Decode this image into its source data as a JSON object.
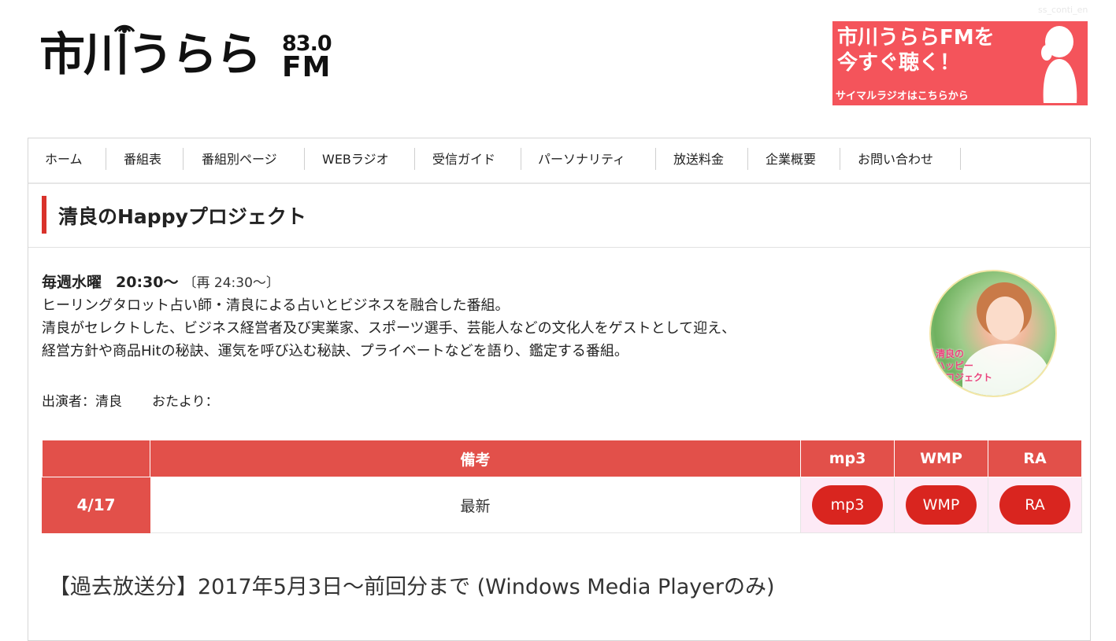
{
  "header": {
    "topnote": "ss_conti_en",
    "logo": {
      "text": "市川うらら",
      "frequency": "83.0",
      "band": "FM"
    },
    "banner": {
      "line1": "市川うららFMを",
      "line2": "今すぐ聴く！",
      "sub": "サイマルラジオはこちらから",
      "bg": "#f4545b"
    }
  },
  "nav": [
    {
      "label": "ホーム"
    },
    {
      "label": "番組表"
    },
    {
      "label": "番組別ページ"
    },
    {
      "label": "WEBラジオ"
    },
    {
      "label": "受信ガイド"
    },
    {
      "label": "パーソナリティ"
    },
    {
      "label": "放送料金"
    },
    {
      "label": "企業概要"
    },
    {
      "label": "お問い合わせ"
    }
  ],
  "program": {
    "title": "清良のHappyプロジェクト",
    "day": "毎週水曜",
    "time": "20:30〜",
    "rebroadcast": "〔再 24:30〜〕",
    "description": [
      "ヒーリングタロット占い師・清良による占いとビジネスを融合した番組。",
      "清良がセレクトした、ビジネス経営者及び実業家、スポーツ選手、芸能人などの文化人をゲストとして迎え、",
      "経営方針や商品Hitの秘訣、運気を呼び込む秘訣、プライベートなどを語り、鑑定する番組。"
    ],
    "cast": "出演者：清良",
    "tayori": "おたより：",
    "image_caption": "清良の\nハッピー\nプロジェクト"
  },
  "table": {
    "headers": [
      "",
      "備考",
      "mp3",
      "WMP",
      "RA"
    ],
    "rows": [
      {
        "date": "4/17",
        "note": "最新",
        "mp3": "mp3",
        "wmp": "WMP",
        "ra": "RA"
      }
    ],
    "accent": "#e2504a",
    "button_color": "#d9251f"
  },
  "archive": "【過去放送分】2017年5月3日〜前回分まで (Windows Media Playerのみ)"
}
